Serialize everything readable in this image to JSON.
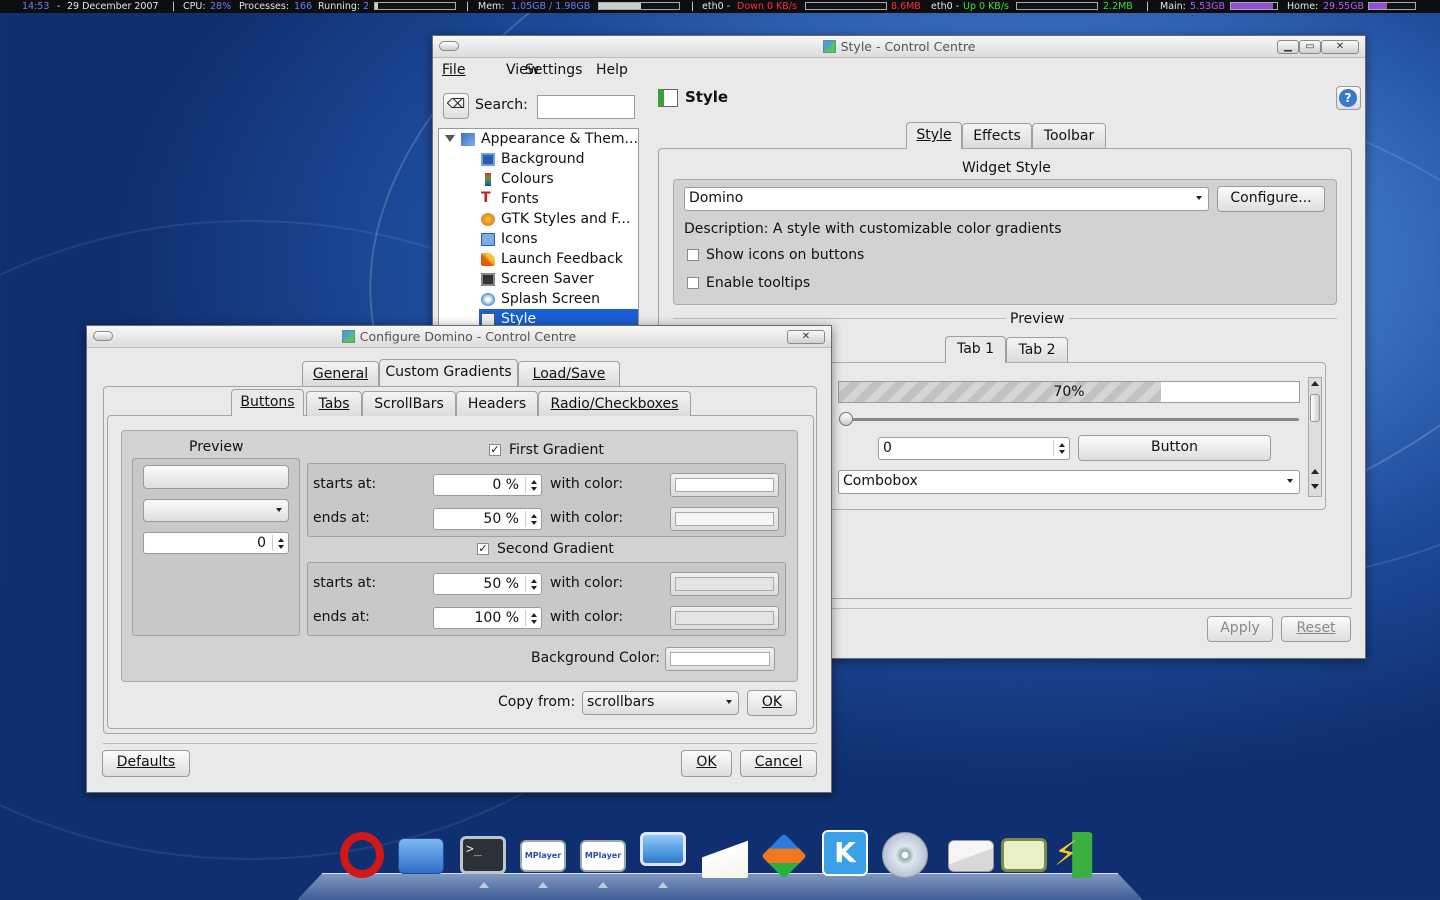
{
  "topbar": {
    "time": "14:53",
    "date": "29 December 2007",
    "cpu_label": "CPU:",
    "cpu_value": "28%",
    "proc_label": "Processes:",
    "proc_value": "166",
    "running_label": "Running:",
    "running_value": "2",
    "mem_label": "Mem:",
    "mem_value": "1.05GB / 1.98GB",
    "eth0_down_label": "eth0 -",
    "eth0_down_value": "Down 0 KB/s",
    "eth0_down_total": "8.6MB",
    "eth0_up_label": "eth0 -",
    "eth0_up_value": "Up 0 KB/s",
    "eth0_up_total": "2.2MB",
    "main_label": "Main:",
    "main_value": "5.53GB",
    "home_label": "Home:",
    "home_value": "29.55GB"
  },
  "style_window": {
    "title": "Style - Control Centre",
    "menu": [
      "File",
      "View",
      "Settings",
      "Help"
    ],
    "search_label": "Search:",
    "search_value": "",
    "page_title": "Style",
    "tree": {
      "root": "Appearance & Them...",
      "items": [
        "Background",
        "Colours",
        "Fonts",
        "GTK Styles and F...",
        "Icons",
        "Launch Feedback",
        "Screen Saver",
        "Splash Screen",
        "Style"
      ],
      "selected": "Style"
    },
    "tabs": [
      "Style",
      "Effects",
      "Toolbar"
    ],
    "active_tab": "Style",
    "widget_style_label": "Widget Style",
    "widget_style_value": "Domino",
    "configure_label": "Configure...",
    "description": "Description: A style with customizable color gradients",
    "show_icons_label": "Show icons on buttons",
    "enable_tooltips_label": "Enable tooltips",
    "preview_label": "Preview",
    "preview_tabs": [
      "Tab 1",
      "Tab 2"
    ],
    "progress_text": "70%",
    "progress_value": 0.7,
    "preview_spin_value": "0",
    "preview_button_label": "Button",
    "preview_combo_value": "Combobox",
    "apply_label": "Apply",
    "reset_label": "Reset"
  },
  "domino_window": {
    "title": "Configure Domino - Control Centre",
    "top_tabs": [
      "General",
      "Custom Gradients",
      "Load/Save"
    ],
    "active_top_tab": "Custom Gradients",
    "sub_tabs": [
      "Buttons",
      "Tabs",
      "ScrollBars",
      "Headers",
      "Radio/Checkboxes"
    ],
    "active_sub_tab": "Buttons",
    "preview_label": "Preview",
    "preview_spin_value": "0",
    "first_gradient_label": "First Gradient",
    "second_gradient_label": "Second Gradient",
    "starts_at_label": "starts at:",
    "ends_at_label": "ends at:",
    "with_color_label": "with color:",
    "first_start": "0 %",
    "first_end": "50 %",
    "second_start": "50 %",
    "second_end": "100 %",
    "background_color_label": "Background Color:",
    "copy_from_label": "Copy from:",
    "copy_from_value": "scrollbars",
    "copy_ok_label": "OK",
    "defaults_label": "Defaults",
    "ok_label": "OK",
    "cancel_label": "Cancel"
  },
  "dock": {
    "icons": [
      "opera-icon",
      "folder-icon",
      "terminal-icon",
      "mplayer-icon",
      "mplayer-icon",
      "computer-icon",
      "text-editor-icon",
      "cubes-icon",
      "kopete-icon",
      "cd-player-icon",
      "mail-icon",
      "notes-icon",
      "power-icon"
    ]
  }
}
